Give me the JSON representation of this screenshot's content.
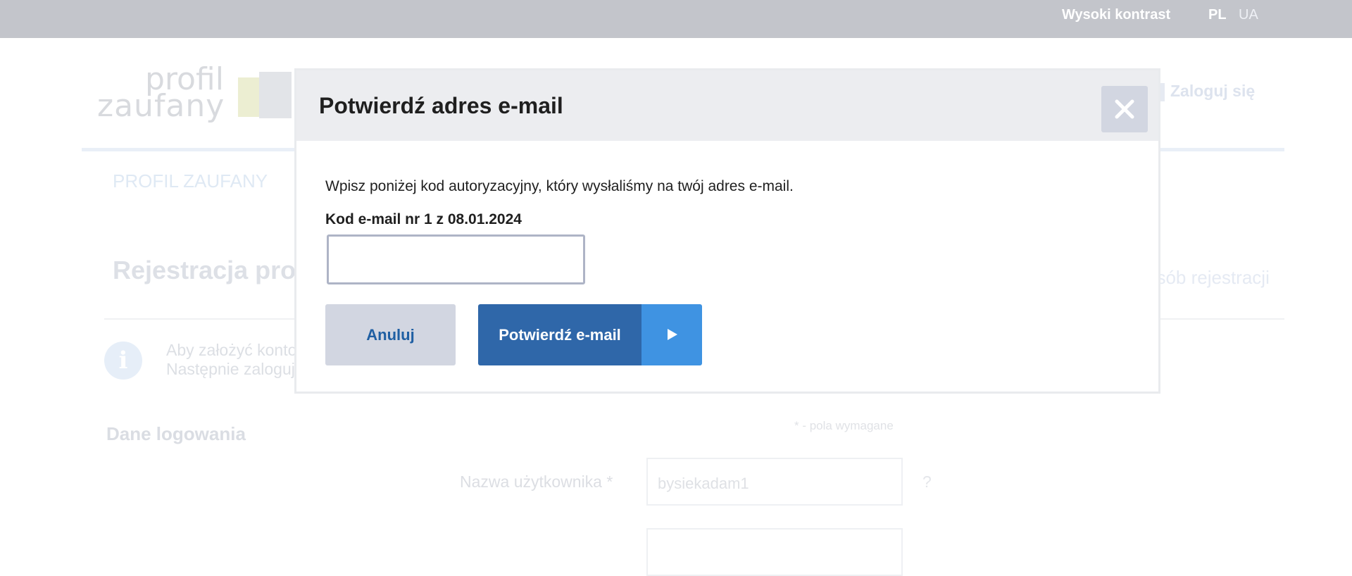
{
  "topbar": {
    "contrast_label": "Wysoki kontrast",
    "lang_pl": "PL",
    "lang_ua": "UA"
  },
  "background": {
    "logo_line1": "profil",
    "logo_line2": "zaufany",
    "login_label": "Zaloguj się",
    "nav_item": "PROFIL ZAUFANY",
    "page_title_visible": "Rejestracja prof",
    "other_way_visible": "osób rejestracji",
    "info_line1": "Aby założyć konto",
    "info_line2": "Następnie zaloguj",
    "section_title": "Dane logowania",
    "required_note": "* - pola wymagane",
    "username_label": "Nazwa użytkownika *",
    "username_value": "bysiekadam1",
    "help_mark": "?"
  },
  "modal": {
    "title": "Potwierdź adres e-mail",
    "description": "Wpisz poniżej kod autoryzacyjny, który wysłaliśmy na twój adres e-mail.",
    "code_label": "Kod e-mail nr 1 z 08.01.2024",
    "code_value": "",
    "cancel_label": "Anuluj",
    "confirm_label": "Potwierdź e-mail"
  },
  "icons": {
    "close": "close-icon",
    "arrow": "play-arrow-icon",
    "info": "info-icon"
  },
  "colors": {
    "primary_button": "#2f67a9",
    "primary_button_arrow": "#3f93e2",
    "secondary_button": "#d2d6e1",
    "secondary_text": "#1f5fa3"
  }
}
